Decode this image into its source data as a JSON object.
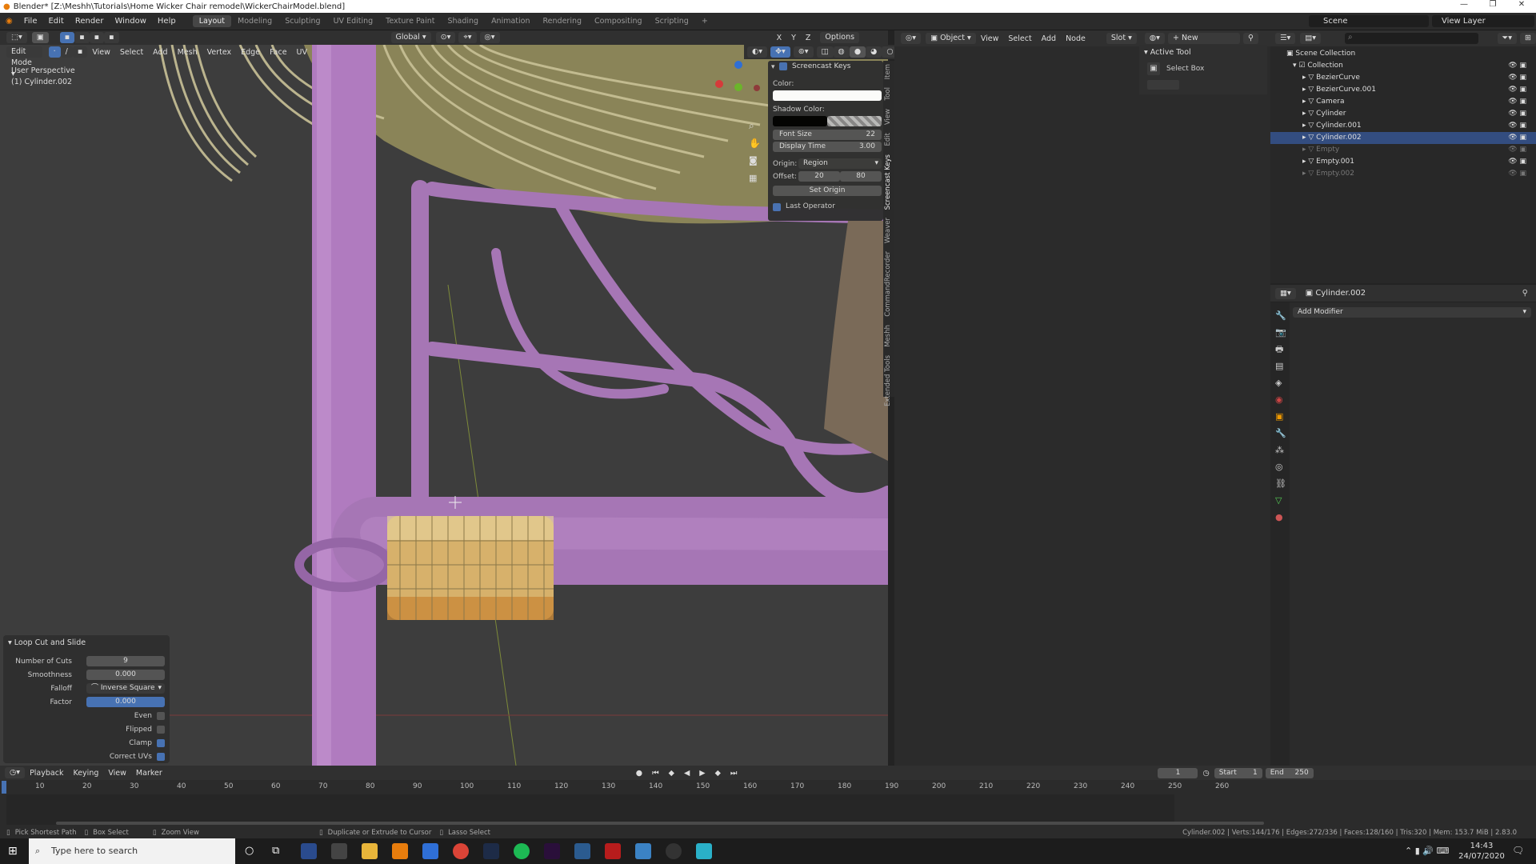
{
  "titlebar": {
    "title": "Blender* [Z:\\Meshh\\Tutorials\\Home Wicker Chair remodel\\WickerChairModel.blend]"
  },
  "menus": [
    "File",
    "Edit",
    "Render",
    "Window",
    "Help"
  ],
  "workspaces": [
    "Layout",
    "Modeling",
    "Sculpting",
    "UV Editing",
    "Texture Paint",
    "Shading",
    "Animation",
    "Rendering",
    "Compositing",
    "Scripting"
  ],
  "active_workspace": "Layout",
  "scene": "Scene",
  "view_layer": "View Layer",
  "viewport": {
    "mode": "Edit Mode",
    "menus": [
      "View",
      "Select",
      "Add",
      "Mesh",
      "Vertex",
      "Edge",
      "Face",
      "UV"
    ],
    "transform": "Global",
    "options": "Options",
    "axes": [
      "X",
      "Y",
      "Z"
    ],
    "perspective": "User Perspective",
    "object": "(1) Cylinder.002"
  },
  "screencast_keys": {
    "title": "Screencast Keys",
    "color_label": "Color:",
    "shadow_label": "Shadow Color:",
    "font_size_label": "Font Size",
    "font_size": "22",
    "display_time_label": "Display Time",
    "display_time": "3.00",
    "origin_label": "Origin:",
    "origin": "Region",
    "offset_label": "Offset:",
    "offset_x": "20",
    "offset_y": "80",
    "set_origin": "Set Origin",
    "last_operator": "Last Operator"
  },
  "npanel_tabs": [
    "Item",
    "Tool",
    "View",
    "Edit",
    "Screencast Keys",
    "Weaver",
    "CommandRecorder",
    "Meshh",
    "Extended Tools"
  ],
  "loop_cut": {
    "title": "Loop Cut and Slide",
    "number_of_cuts_label": "Number of Cuts",
    "number_of_cuts": "9",
    "smoothness_label": "Smoothness",
    "smoothness": "0.000",
    "falloff_label": "Falloff",
    "falloff": "Inverse Square",
    "factor_label": "Factor",
    "factor": "0.000",
    "even": "Even",
    "flipped": "Flipped",
    "clamp": "Clamp",
    "correct_uvs": "Correct UVs"
  },
  "node_editor": {
    "object_label": "Object",
    "menus": [
      "View",
      "Select",
      "Add",
      "Node"
    ],
    "slot": "Slot",
    "new": "New",
    "active_tool_title": "Active Tool",
    "active_tool": "Select Box"
  },
  "outliner": {
    "scene_collection": "Scene Collection",
    "collection": "Collection",
    "items": [
      {
        "name": "BezierCurve",
        "dim": false,
        "sel": false
      },
      {
        "name": "BezierCurve.001",
        "dim": false,
        "sel": false
      },
      {
        "name": "Camera",
        "dim": false,
        "sel": false
      },
      {
        "name": "Cylinder",
        "dim": false,
        "sel": false
      },
      {
        "name": "Cylinder.001",
        "dim": false,
        "sel": false
      },
      {
        "name": "Cylinder.002",
        "dim": false,
        "sel": true
      },
      {
        "name": "Empty",
        "dim": true,
        "sel": false
      },
      {
        "name": "Empty.001",
        "dim": false,
        "sel": false
      },
      {
        "name": "Empty.002",
        "dim": true,
        "sel": false
      }
    ]
  },
  "properties": {
    "object": "Cylinder.002",
    "add_modifier": "Add Modifier"
  },
  "timeline": {
    "menus": [
      "Playback",
      "Keying",
      "View",
      "Marker"
    ],
    "current_frame": "1",
    "start_label": "Start",
    "start": "1",
    "end_label": "End",
    "end": "250",
    "ticks": [
      "10",
      "20",
      "30",
      "40",
      "50",
      "60",
      "70",
      "80",
      "90",
      "100",
      "110",
      "120",
      "130",
      "140",
      "150",
      "160",
      "170",
      "180",
      "190",
      "200",
      "210",
      "220",
      "230",
      "240",
      "250",
      "260"
    ]
  },
  "statusbar": {
    "left": [
      "Pick Shortest Path",
      "Box Select",
      "Zoom View"
    ],
    "middle": [
      "Duplicate or Extrude to Cursor",
      "Lasso Select"
    ],
    "stats": "Cylinder.002 | Verts:144/176 | Edges:272/336 | Faces:128/160 | Tris:320 | Mem: 153.7 MiB | 2.83.0"
  },
  "taskbar": {
    "search": "Type here to search",
    "time": "14:43",
    "date": "24/07/2020"
  }
}
